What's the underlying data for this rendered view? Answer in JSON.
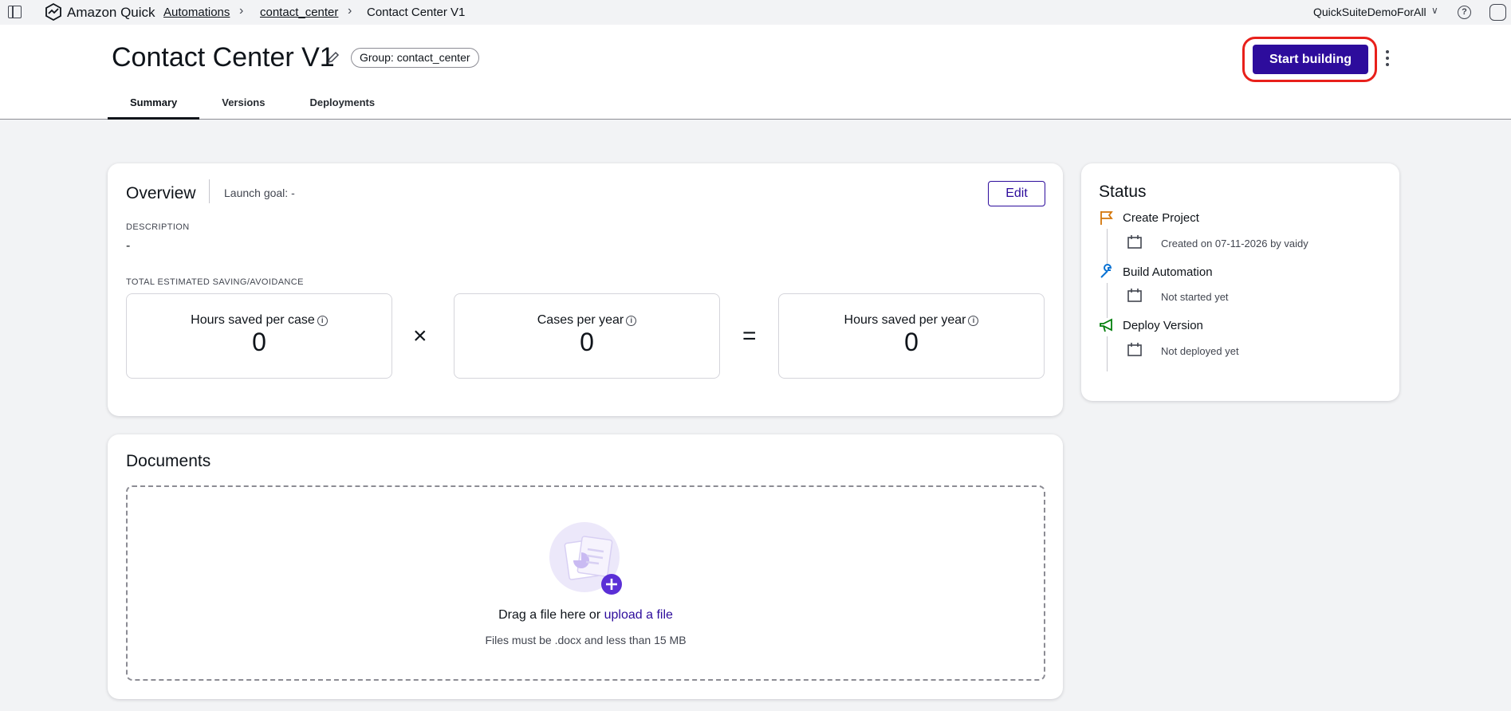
{
  "nav": {
    "brand": "Amazon Quick",
    "breadcrumbs": [
      "Automations",
      "contact_center",
      "Contact Center V1"
    ],
    "account": "QuickSuiteDemoForAll"
  },
  "header": {
    "title": "Contact Center V1",
    "group_pill": "Group: contact_center",
    "start_button": "Start building",
    "tabs": [
      "Summary",
      "Versions",
      "Deployments"
    ]
  },
  "overview": {
    "heading": "Overview",
    "launch_goal": "Launch goal: -",
    "edit_label": "Edit",
    "description_label": "DESCRIPTION",
    "description_value": "-",
    "savings_label": "TOTAL ESTIMATED SAVING/AVOIDANCE",
    "metrics": [
      {
        "label": "Hours saved per case",
        "value": "0"
      },
      {
        "label": "Cases per year",
        "value": "0"
      },
      {
        "label": "Hours saved per year",
        "value": "0"
      }
    ],
    "multiply": "×",
    "equals": "="
  },
  "status": {
    "heading": "Status",
    "steps": [
      {
        "title": "Create Project",
        "detail": "Created on 07-11-2026 by vaidy",
        "icon": "flag-icon",
        "color": "#d4760a"
      },
      {
        "title": "Build Automation",
        "detail": "Not started yet",
        "icon": "wrench-icon",
        "color": "#0972d3"
      },
      {
        "title": "Deploy Version",
        "detail": "Not deployed yet",
        "icon": "megaphone-icon",
        "color": "#037f0c"
      }
    ]
  },
  "documents": {
    "heading": "Documents",
    "drop_text": "Drag a file here or",
    "upload_link": "upload a file",
    "hint": "Files must be .docx and less than 15 MB"
  },
  "colors": {
    "primary": "#2d0c9c",
    "highlight_ring": "#e8201b"
  }
}
